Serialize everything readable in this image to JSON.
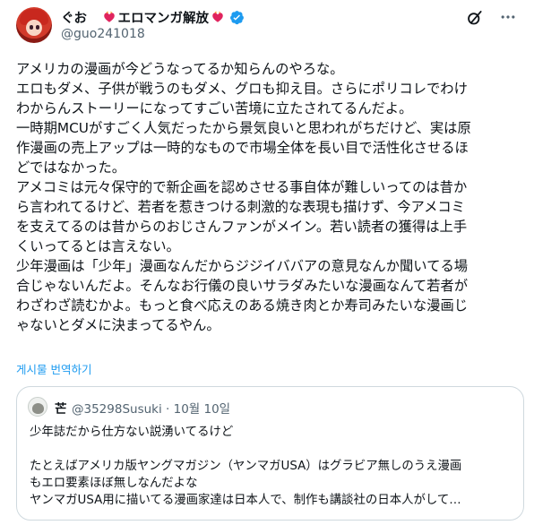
{
  "post": {
    "display_name": "ぐお　",
    "display_name_tag": "エロマンガ解放",
    "handle": "@guo241018",
    "body_lines": [
      "アメリカの漫画が今どうなってるか知らんのやろな。",
      "エロもダメ、子供が戦うのもダメ、グロも抑え目。さらにポリコレでわけ",
      "わからんストーリーになってすごい苦境に立たされてるんだよ。",
      "一時期MCUがすごく人気だったから景気良いと思われがちだけど、実は原",
      "作漫画の売上アップは一時的なもので市場全体を長い目で活性化させるほ",
      "どではなかった。",
      "アメコミは元々保守的で新企画を認めさせる事自体が難しいってのは昔か",
      "ら言われてるけど、若者を惹きつける刺激的な表現も描けず、今アメコミ",
      "を支えてるのは昔からのおじさんファンがメイン。若い読者の獲得は上手",
      "くいってるとは言えない。",
      "少年漫画は「少年」漫画なんだからジジイババアの意見なんか聞いてる場",
      "合じゃないんだよ。そんなお行儀の良いサラダみたいな漫画なんて若者が",
      "わざわざ読むかよ。もっと食べ応えのある焼き肉とか寿司みたいな漫画じ",
      "ゃないとダメに決まってるやん。"
    ],
    "translate_label": "게시물 번역하기"
  },
  "quote": {
    "name": "芒",
    "meta": "@35298Susuki · 10월 10일",
    "lines": [
      "少年誌だから仕方ない説湧いてるけど",
      "",
      "たとえばアメリカ版ヤングマガジン（ヤンマガUSA）はグラビア無しのうえ漫画",
      "もエロ要素ほぼ無しなんだよな",
      "ヤンマガUSA用に描いてる漫画家達は日本人で、制作も講談社の日本人がして…"
    ]
  },
  "colors": {
    "text": "#0f1419",
    "secondary": "#536471",
    "link": "#1d9bf0",
    "verified": "#1d9bf0",
    "border": "#cfd9de",
    "heart": "#e0245e"
  },
  "icons": {
    "left_heart": "burning-heart-icon",
    "right_heart": "burning-heart-icon",
    "verified": "verified-badge-icon",
    "grok": "grok-icon",
    "more": "more-icon"
  }
}
